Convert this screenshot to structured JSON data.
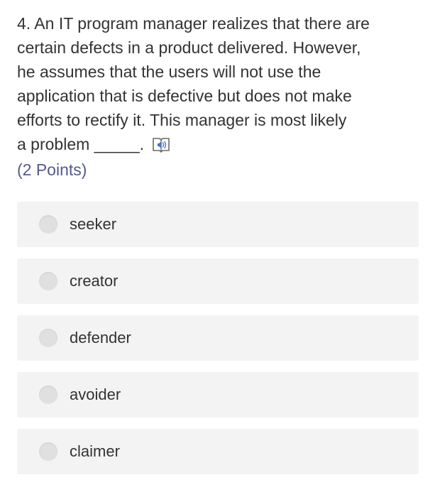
{
  "question": {
    "lines": [
      "4. An IT program manager realizes that there are",
      "certain defects in a product delivered. However,",
      "he assumes that the users will not use the",
      "application that is defective but does not make",
      "efforts to rectify it. This manager is most likely",
      "a problem _____."
    ],
    "reader_icon": "immersive-reader-icon",
    "points": "(2 Points)"
  },
  "options": [
    {
      "label": "seeker"
    },
    {
      "label": "creator"
    },
    {
      "label": "defender"
    },
    {
      "label": "avoider"
    },
    {
      "label": "claimer"
    }
  ],
  "colors": {
    "text": "#333333",
    "points": "#555a8a",
    "option_bg": "#f3f3f3",
    "radio": "#e0e0e0",
    "icon_accent": "#4a6fd1"
  }
}
